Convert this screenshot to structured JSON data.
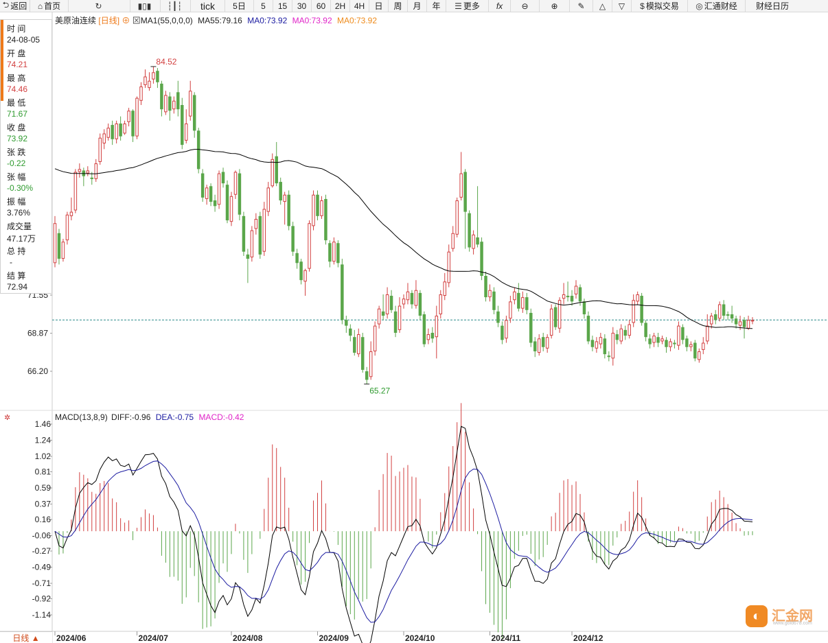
{
  "toolbar": {
    "back": "返回",
    "home": "首页",
    "tick": "tick",
    "periods": [
      "5日",
      "5",
      "15",
      "30",
      "60",
      "2H",
      "4H",
      "日",
      "周",
      "月",
      "年"
    ],
    "more": "更多",
    "sim_trade": "模拟交易",
    "brand": "汇通财经",
    "calendar": "财经日历"
  },
  "info": {
    "time_label": "时 间",
    "time": "24-08-05",
    "open_label": "开 盘",
    "open": "74.21",
    "high_label": "最 高",
    "high": "74.46",
    "low_label": "最 低",
    "low": "71.67",
    "close_label": "收 盘",
    "close": "73.92",
    "change_label": "张 跌",
    "change": "-0.22",
    "pct_label": "张 幅",
    "pct": "-0.30%",
    "amp_label": "振 幅",
    "amp": "3.76%",
    "vol_label": "成交量",
    "vol": "47.17万",
    "oi_label": "总 持",
    "oi": "-",
    "settle_label": "结 算",
    "settle": "72.94"
  },
  "legend": {
    "title": "美原油连续",
    "period": "[日线]",
    "ma_label": "MA1(55,0,0,0)",
    "ma55": "MA55:79.16",
    "ma0a": "MA0:73.92",
    "ma0b": "MA0:73.92",
    "ma0c": "MA0:73.92"
  },
  "macd_legend": {
    "label": "MACD(13,8,9)",
    "diff": "DIFF:-0.96",
    "dea": "DEA:-0.75",
    "macd": "MACD:-0.42"
  },
  "bottom": {
    "period": "日线 ▲"
  },
  "logo": {
    "name": "汇金网",
    "url": "www.gold678.com"
  },
  "colors": {
    "up": "#d23f3f",
    "down": "#5aa64a",
    "ma": "#000000",
    "dea": "#1a1aa0",
    "accent": "#ee7a1a"
  },
  "chart_data": {
    "type": "candlestick",
    "title": "美原油连续",
    "price_axis_ticks": [
      71.55,
      68.87,
      66.2
    ],
    "macd_axis_ticks": [
      1.46,
      1.24,
      1.02,
      0.81,
      0.59,
      0.37,
      0.16,
      -0.06,
      -0.27,
      -0.49,
      -0.71,
      -0.92,
      -1.14
    ],
    "x_month_labels": [
      "2024/06",
      "2024/07",
      "2024/08",
      "2024/09",
      "2024/10",
      "2024/11",
      "2024/12"
    ],
    "annotations": {
      "high": "84.52",
      "low": "65.27"
    },
    "last_price": 69.8,
    "candles": [
      [
        73.8,
        76.6,
        77.1,
        73.5
      ],
      [
        75.9,
        74.1,
        76.2,
        73.7
      ],
      [
        74.1,
        75.3,
        75.5,
        73.9
      ],
      [
        75.4,
        77.2,
        77.4,
        75.1
      ],
      [
        77.1,
        77.4,
        78.4,
        76.8
      ],
      [
        77.5,
        80.2,
        80.4,
        77.3
      ],
      [
        80.2,
        80.4,
        80.8,
        79.8
      ],
      [
        80.3,
        79.9,
        80.5,
        79.2
      ],
      [
        80.1,
        80.3,
        80.6,
        79.9
      ],
      [
        79.8,
        79.7,
        80.2,
        79.3
      ],
      [
        79.7,
        80.8,
        81.1,
        79.5
      ],
      [
        80.9,
        82.6,
        82.9,
        80.7
      ],
      [
        82.2,
        82.9,
        83.2,
        81.8
      ],
      [
        82.6,
        83.3,
        83.6,
        82.4
      ],
      [
        83.5,
        82.5,
        83.8,
        82.1
      ],
      [
        82.5,
        83.6,
        83.8,
        82.2
      ],
      [
        83.6,
        82.7,
        84.1,
        82.4
      ],
      [
        82.9,
        83.6,
        83.8,
        82.8
      ],
      [
        83.7,
        84.5,
        84.7,
        83.4
      ],
      [
        84.5,
        82.7,
        84.6,
        82.3
      ],
      [
        82.7,
        85.4,
        85.5,
        82.5
      ],
      [
        85.2,
        86.2,
        86.5,
        84.9
      ],
      [
        86.3,
        86.9,
        87.4,
        86.1
      ],
      [
        86.1,
        86.6,
        87.2,
        85.9
      ],
      [
        86.7,
        87.2,
        87.6,
        86.4
      ],
      [
        87.3,
        86.5,
        87.5,
        86.1
      ],
      [
        86.4,
        84.6,
        86.6,
        84.1
      ],
      [
        84.4,
        85.6,
        85.9,
        84.2
      ],
      [
        85.5,
        84.5,
        85.8,
        83.8
      ],
      [
        84.6,
        85.2,
        85.5,
        84.3
      ],
      [
        85.8,
        84.6,
        86.6,
        84.1
      ],
      [
        84.9,
        82.1,
        85.4,
        81.8
      ],
      [
        82.4,
        83.6,
        84.6,
        82.2
      ],
      [
        84.1,
        85.9,
        86.6,
        83.8
      ],
      [
        85.6,
        83.1,
        85.8,
        82.6
      ],
      [
        83.1,
        80.4,
        83.3,
        80.1
      ],
      [
        80.1,
        78.4,
        80.4,
        78.1
      ],
      [
        78.3,
        79.1,
        79.3,
        77.9
      ],
      [
        79.2,
        78.1,
        79.4,
        77.8
      ],
      [
        78.2,
        77.8,
        78.6,
        77.4
      ],
      [
        77.9,
        80.1,
        80.3,
        77.6
      ],
      [
        80.2,
        79.4,
        80.5,
        79.1
      ],
      [
        79.3,
        76.8,
        79.6,
        76.6
      ],
      [
        76.7,
        78.5,
        78.8,
        76.4
      ],
      [
        78.6,
        80.2,
        80.3,
        78.3
      ],
      [
        80.1,
        77.2,
        80.4,
        76.8
      ],
      [
        77.1,
        74.6,
        77.4,
        74.3
      ],
      [
        74.4,
        74.1,
        74.8,
        72.4
      ],
      [
        74.2,
        76.1,
        76.4,
        73.9
      ],
      [
        76.2,
        76.9,
        77.3,
        75.8
      ],
      [
        77.1,
        74.4,
        77.4,
        74.1
      ],
      [
        74.6,
        77.6,
        78.1,
        74.3
      ],
      [
        77.4,
        79.1,
        79.5,
        77.1
      ],
      [
        79.2,
        81.1,
        81.5,
        79.1
      ],
      [
        81.3,
        79.4,
        82.3,
        79.2
      ],
      [
        79.5,
        78.2,
        79.8,
        77.9
      ],
      [
        78.1,
        78.6,
        78.8,
        76.5
      ],
      [
        78.6,
        76.4,
        78.9,
        76.1
      ],
      [
        76.4,
        74.6,
        76.7,
        74.3
      ],
      [
        74.5,
        73.8,
        74.8,
        73.4
      ],
      [
        73.9,
        72.6,
        74.1,
        72.3
      ],
      [
        72.5,
        73.3,
        73.4,
        71.5
      ],
      [
        73.4,
        76.6,
        76.8,
        73.2
      ],
      [
        76.4,
        78.6,
        78.9,
        76.1
      ],
      [
        78.6,
        77.1,
        78.9,
        76.8
      ],
      [
        77.1,
        78.2,
        78.5,
        76.9
      ],
      [
        78.3,
        75.4,
        78.6,
        75.1
      ],
      [
        75.2,
        73.9,
        75.4,
        73.5
      ],
      [
        73.9,
        75.3,
        75.6,
        73.7
      ],
      [
        75.2,
        73.8,
        75.4,
        73.5
      ],
      [
        73.7,
        69.8,
        74.1,
        69.5
      ],
      [
        69.8,
        69.4,
        70.1,
        68.9
      ],
      [
        69.2,
        68.7,
        69.5,
        68.3
      ],
      [
        68.6,
        67.5,
        69.1,
        67.3
      ],
      [
        67.4,
        68.8,
        69.2,
        67.2
      ],
      [
        68.6,
        66.3,
        68.9,
        66.1
      ],
      [
        66.2,
        65.6,
        66.5,
        65.3
      ],
      [
        65.8,
        67.6,
        68.3,
        65.6
      ],
      [
        67.6,
        69.4,
        69.7,
        67.3
      ],
      [
        69.5,
        70.6,
        70.8,
        69.2
      ],
      [
        70.4,
        70.1,
        71.6,
        69.8
      ],
      [
        70.2,
        71.6,
        72.1,
        69.9
      ],
      [
        71.5,
        70.5,
        71.9,
        70.3
      ],
      [
        70.4,
        68.9,
        70.8,
        68.6
      ],
      [
        69.1,
        70.8,
        71.4,
        68.9
      ],
      [
        70.9,
        71.3,
        71.6,
        70.6
      ],
      [
        71.2,
        71.8,
        72.4,
        70.9
      ],
      [
        71.7,
        70.9,
        71.9,
        70.6
      ],
      [
        70.8,
        71.9,
        72.6,
        70.6
      ],
      [
        71.7,
        70.1,
        71.9,
        69.8
      ],
      [
        70.2,
        68.1,
        70.4,
        67.9
      ],
      [
        68.4,
        68.8,
        69.2,
        68.1
      ],
      [
        68.9,
        68.5,
        69.3,
        68.2
      ],
      [
        68.6,
        70.1,
        70.8,
        67.1
      ],
      [
        70.2,
        71.6,
        71.9,
        69.9
      ],
      [
        71.5,
        72.5,
        73.1,
        71.2
      ],
      [
        72.4,
        74.6,
        75.1,
        72.1
      ],
      [
        74.8,
        75.9,
        76.4,
        74.6
      ],
      [
        75.8,
        78.2,
        78.4,
        75.6
      ],
      [
        78.4,
        80.1,
        81.6,
        78.2
      ],
      [
        80.2,
        77.4,
        80.4,
        74.8
      ],
      [
        77.3,
        74.9,
        77.5,
        74.6
      ],
      [
        74.8,
        75.8,
        76.1,
        74.4
      ],
      [
        75.6,
        75.1,
        79.2,
        74.9
      ],
      [
        75.3,
        72.9,
        75.6,
        72.6
      ],
      [
        72.9,
        71.4,
        73.2,
        71.1
      ],
      [
        71.4,
        71.9,
        72.3,
        71.1
      ],
      [
        71.8,
        70.5,
        72.1,
        70.2
      ],
      [
        70.4,
        69.6,
        70.8,
        69.3
      ],
      [
        69.4,
        68.4,
        69.7,
        68.1
      ],
      [
        68.5,
        69.8,
        70.1,
        68.2
      ],
      [
        69.9,
        71.1,
        71.5,
        69.6
      ],
      [
        71.2,
        71.8,
        72.1,
        70.9
      ],
      [
        71.7,
        70.6,
        72.4,
        70.4
      ],
      [
        70.6,
        71.4,
        71.8,
        70.3
      ],
      [
        71.4,
        70.5,
        71.7,
        70.2
      ],
      [
        70.3,
        68.2,
        70.6,
        67.9
      ],
      [
        68.3,
        67.6,
        68.6,
        67.2
      ],
      [
        67.5,
        68.5,
        68.8,
        67.3
      ],
      [
        68.6,
        67.9,
        68.9,
        67.6
      ],
      [
        67.8,
        68.6,
        68.8,
        67.5
      ],
      [
        68.7,
        70.6,
        70.9,
        68.5
      ],
      [
        70.7,
        69.3,
        70.9,
        69.1
      ],
      [
        69.2,
        71.2,
        71.4,
        68.9
      ],
      [
        71.3,
        71.6,
        72.4,
        70.9
      ],
      [
        71.5,
        71.4,
        72.5,
        71.1
      ],
      [
        71.5,
        71.1,
        71.9,
        70.8
      ],
      [
        71.6,
        72.2,
        72.6,
        71.3
      ],
      [
        72.1,
        71.1,
        72.3,
        70.8
      ],
      [
        71.1,
        70.2,
        71.3,
        69.9
      ],
      [
        70.1,
        68.3,
        70.4,
        68.1
      ],
      [
        68.4,
        67.9,
        68.7,
        67.6
      ],
      [
        67.8,
        68.3,
        68.6,
        67.5
      ],
      [
        68.1,
        68.6,
        68.9,
        67.8
      ],
      [
        68.5,
        67.4,
        68.8,
        67.1
      ],
      [
        67.3,
        67.2,
        67.6,
        66.9
      ],
      [
        67.1,
        68.9,
        69.3,
        66.6
      ],
      [
        68.8,
        68.4,
        69.1,
        68.1
      ],
      [
        68.3,
        69.2,
        69.5,
        68.1
      ],
      [
        69.1,
        68.7,
        69.4,
        68.4
      ],
      [
        68.7,
        69.5,
        69.8,
        68.5
      ],
      [
        69.6,
        71.2,
        71.6,
        69.3
      ],
      [
        71.1,
        71.6,
        71.8,
        70.9
      ],
      [
        71.5,
        69.6,
        71.7,
        69.4
      ],
      [
        69.6,
        68.6,
        69.8,
        68.3
      ],
      [
        68.5,
        68.1,
        68.8,
        67.8
      ],
      [
        68.2,
        68.7,
        68.9,
        67.9
      ],
      [
        68.6,
        68.2,
        68.9,
        67.9
      ],
      [
        68.3,
        68.5,
        68.7,
        68.1
      ],
      [
        68.4,
        67.9,
        68.6,
        67.5
      ],
      [
        67.9,
        68.3,
        68.5,
        67.6
      ],
      [
        68.2,
        68.1,
        68.4,
        67.8
      ],
      [
        68.0,
        69.4,
        69.7,
        67.7
      ],
      [
        69.3,
        68.4,
        69.5,
        68.1
      ],
      [
        68.5,
        67.9,
        68.7,
        67.6
      ],
      [
        67.9,
        68.1,
        68.3,
        67.6
      ],
      [
        68.2,
        67.1,
        68.4,
        66.9
      ],
      [
        67.0,
        67.6,
        67.8,
        66.8
      ],
      [
        67.7,
        68.2,
        68.6,
        67.4
      ],
      [
        68.3,
        69.4,
        70.2,
        68.1
      ],
      [
        69.5,
        70.1,
        70.3,
        69.2
      ],
      [
        70.2,
        69.8,
        70.5,
        69.5
      ],
      [
        69.9,
        70.9,
        71.1,
        69.7
      ],
      [
        70.9,
        70.1,
        71.2,
        69.8
      ],
      [
        70.2,
        70.1,
        70.4,
        69.8
      ],
      [
        70.2,
        69.9,
        70.8,
        69.6
      ],
      [
        69.9,
        69.5,
        70.1,
        69.2
      ],
      [
        69.4,
        69.7,
        70.1,
        69.1
      ],
      [
        69.8,
        69.3,
        70.0,
        68.5
      ],
      [
        69.2,
        69.8,
        70.1,
        69.1
      ],
      [
        69.7,
        69.8,
        70.0,
        69.5
      ]
    ]
  }
}
